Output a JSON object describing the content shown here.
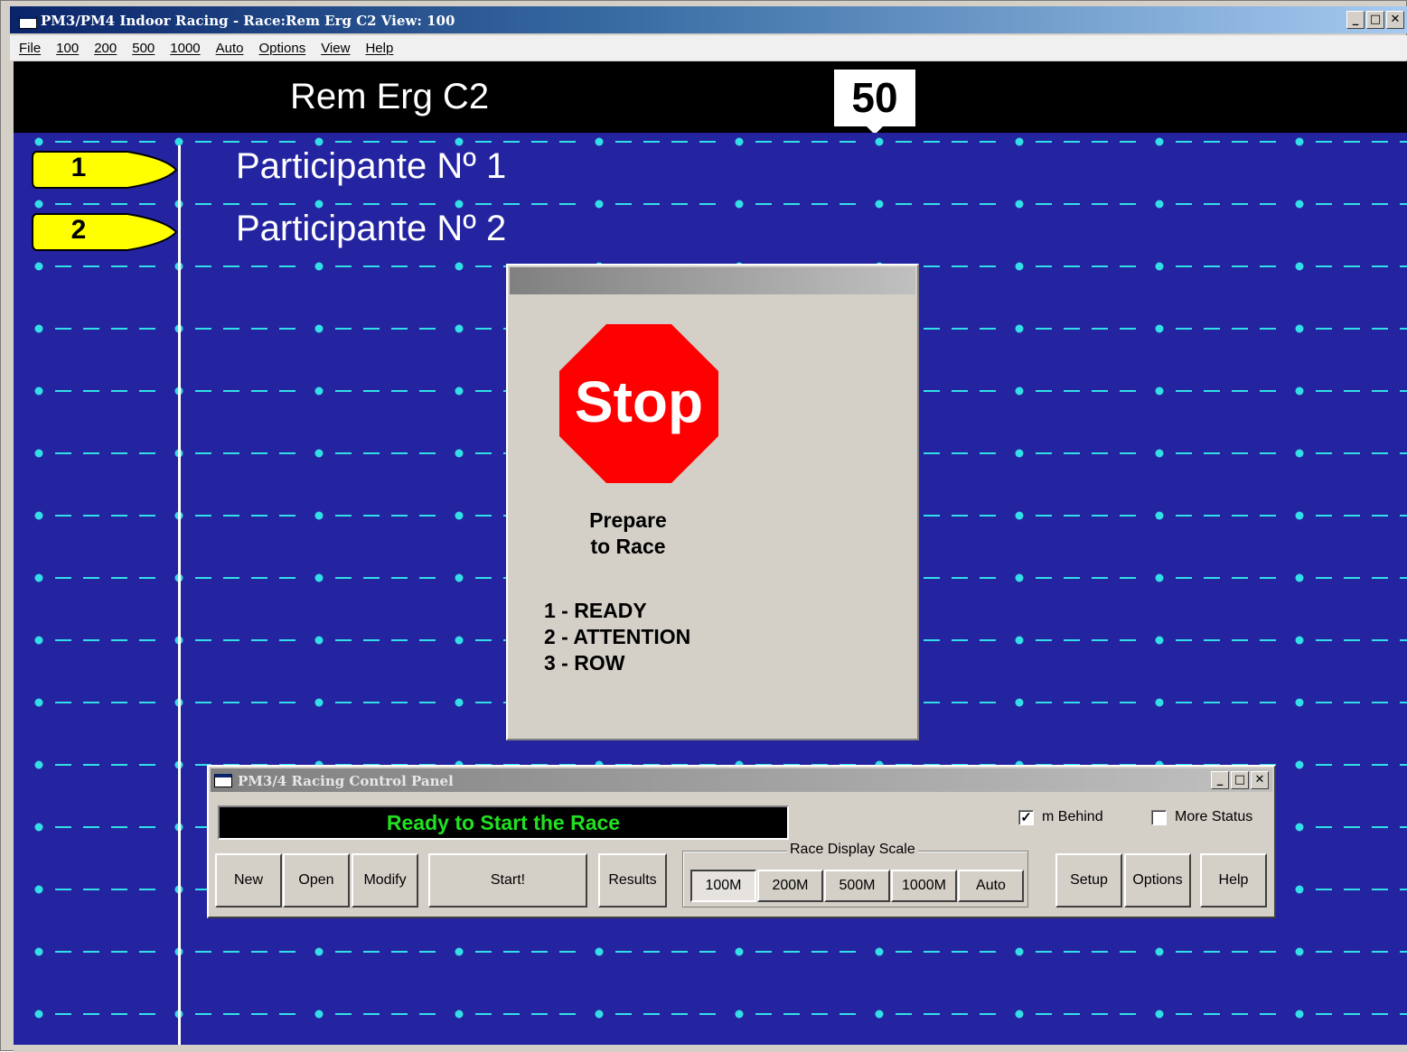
{
  "window": {
    "title": "PM3/PM4 Indoor Racing - Race:Rem Erg C2  View: 100",
    "minimize_glyph": "_",
    "maximize_glyph": "□",
    "close_glyph": "✕"
  },
  "menu": {
    "items": [
      "File",
      "100",
      "200",
      "500",
      "1000",
      "Auto",
      "Options",
      "View",
      "Help"
    ]
  },
  "race": {
    "name": "Rem Erg C2",
    "distance_marker": "50",
    "participants": [
      {
        "number": "1",
        "name": "Participante Nº 1"
      },
      {
        "number": "2",
        "name": "Participante Nº 2"
      }
    ],
    "colors": {
      "water": "#2424a0",
      "lane_line": "#33dfe6",
      "boat": "#ffff00"
    }
  },
  "stop_dialog": {
    "sign_text": "Stop",
    "prepare_line1": "Prepare",
    "prepare_line2": "to Race",
    "commands": [
      "1 - READY",
      "2 - ATTENTION",
      "3 - ROW"
    ]
  },
  "control_panel": {
    "title": "PM3/4 Racing Control Panel",
    "status": "Ready to Start the Race",
    "m_behind": {
      "label": "m Behind",
      "checked": true
    },
    "more_status": {
      "label": "More Status",
      "checked": false
    },
    "buttons": {
      "new": "New",
      "open": "Open",
      "modify": "Modify",
      "start": "Start!",
      "results": "Results",
      "setup": "Setup",
      "options": "Options",
      "help": "Help"
    },
    "scale": {
      "legend": "Race Display Scale",
      "options": [
        "100M",
        "200M",
        "500M",
        "1000M",
        "Auto"
      ],
      "selected": "100M"
    }
  }
}
